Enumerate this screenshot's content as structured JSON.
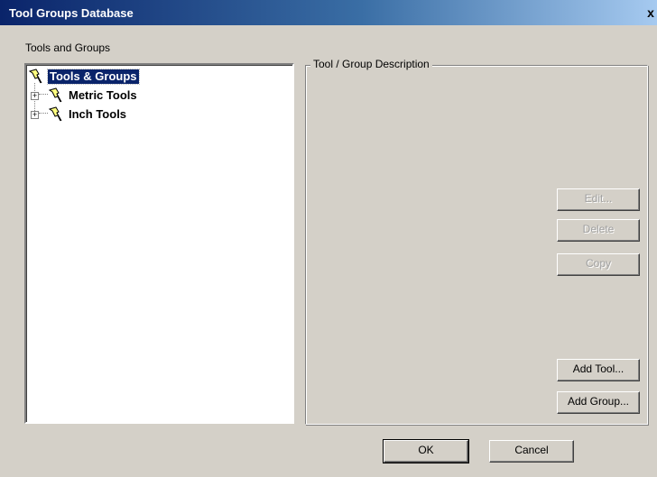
{
  "window": {
    "title": "Tool Groups Database",
    "close_label": "x"
  },
  "tree_panel": {
    "label": "Tools and Groups",
    "nodes": [
      {
        "label": "Tools & Groups",
        "selected": true,
        "icon": "pushpin-group-icon"
      },
      {
        "label": "Metric Tools",
        "expander": "+",
        "icon": "pushpin-group-icon"
      },
      {
        "label": "Inch Tools",
        "expander": "+",
        "icon": "pushpin-group-icon"
      }
    ]
  },
  "description_panel": {
    "legend": "Tool / Group Description"
  },
  "buttons": {
    "edit": "Edit...",
    "delete": "Delete",
    "copy": "Copy",
    "add_tool": "Add Tool...",
    "add_group": "Add Group...",
    "ok": "OK",
    "cancel": "Cancel"
  },
  "colors": {
    "face": "#d4d0c8",
    "title_start": "#0a246a",
    "selection": "#0a246a",
    "disabled_text": "#a0a0a0"
  }
}
